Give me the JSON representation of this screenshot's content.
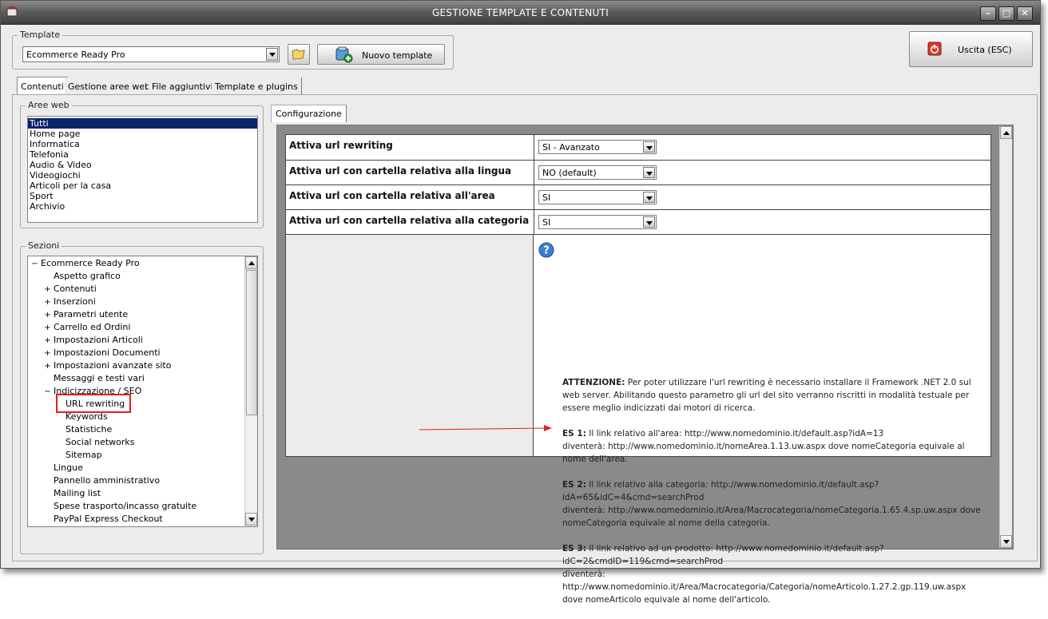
{
  "window": {
    "title": "GESTIONE TEMPLATE E CONTENUTI"
  },
  "template": {
    "group_label": "Template",
    "selected": "Ecommerce Ready Pro",
    "new_button": "Nuovo template"
  },
  "exit_button": "Uscita (ESC)",
  "tabs": [
    "Contenuti",
    "Gestione aree web",
    "File aggiuntivi",
    "Template e plugins"
  ],
  "aree_web": {
    "label": "Aree web",
    "items": [
      "Tutti",
      "Home page",
      "Informatica",
      "Telefonia",
      "Audio & Video",
      "Videogiochi",
      "Articoli per la casa",
      "Sport",
      "Archivio"
    ]
  },
  "sezioni": {
    "label": "Sezioni",
    "nodes": [
      {
        "text": "Ecommerce Ready Pro",
        "level": 0,
        "exp": "−"
      },
      {
        "text": "Aspetto grafico",
        "level": 1,
        "exp": ""
      },
      {
        "text": "Contenuti",
        "level": 1,
        "exp": "+"
      },
      {
        "text": "Inserzioni",
        "level": 1,
        "exp": "+"
      },
      {
        "text": "Parametri utente",
        "level": 1,
        "exp": "+"
      },
      {
        "text": "Carrello ed Ordini",
        "level": 1,
        "exp": "+"
      },
      {
        "text": "Impostazioni Articoli",
        "level": 1,
        "exp": "+"
      },
      {
        "text": "Impostazioni Documenti",
        "level": 1,
        "exp": "+"
      },
      {
        "text": "Impostazioni avanzate sito",
        "level": 1,
        "exp": "+"
      },
      {
        "text": "Messaggi e testi vari",
        "level": 1,
        "exp": ""
      },
      {
        "text": "Indicizzazione / SEO",
        "level": 1,
        "exp": "−"
      },
      {
        "text": "URL rewriting",
        "level": 2,
        "exp": ""
      },
      {
        "text": "Keywords",
        "level": 2,
        "exp": ""
      },
      {
        "text": "Statistiche",
        "level": 2,
        "exp": ""
      },
      {
        "text": "Social networks",
        "level": 2,
        "exp": ""
      },
      {
        "text": "Sitemap",
        "level": 2,
        "exp": ""
      },
      {
        "text": "Lingue",
        "level": 1,
        "exp": ""
      },
      {
        "text": "Pannello amministrativo",
        "level": 1,
        "exp": ""
      },
      {
        "text": "Mailing list",
        "level": 1,
        "exp": ""
      },
      {
        "text": "Spese trasporto/incasso gratuite",
        "level": 1,
        "exp": ""
      },
      {
        "text": "PayPal Express Checkout",
        "level": 1,
        "exp": ""
      }
    ]
  },
  "config": {
    "tab": "Configurazione",
    "rows": [
      {
        "label": "Attiva url rewriting",
        "value": "SI - Avanzato"
      },
      {
        "label": "Attiva url con cartella relativa alla lingua",
        "value": "NO (default)"
      },
      {
        "label": "Attiva url con cartella relativa all'area",
        "value": "SI"
      },
      {
        "label": "Attiva url con cartella relativa alla categoria",
        "value": "SI"
      }
    ],
    "info": {
      "attention_title": "ATTENZIONE:",
      "attention_text": " Per poter utilizzare l'url rewriting è necessario installare il Framework .NET 2.0 sul web server. Abilitando questo parametro gli url del sito verranno riscritti in modalità testuale per essere meglio indicizzati dai motori di ricerca.",
      "ex1_title": "ES 1:",
      "ex1_text": " Il link relativo all'area: http://www.nomedominio.it/default.asp?idA=13",
      "ex1_text2": "diventerà: http://www.nomedominio.it/nomeArea.1.13.uw.aspx dove nomeCategoria equivale al nome dell'area.",
      "ex2_title": "ES 2:",
      "ex2_text": " Il link relativo alla categoria: http://www.nomedominio.it/default.asp?idA=65&idC=4&cmd=searchProd",
      "ex2_text2": "diventerà: http://www.nomedominio.it/Area/Macrocategoria/nomeCategoria.1.65.4.sp.uw.aspx dove nomeCategoria equivale al nome della categoria.",
      "ex3_title": "ES 3:",
      "ex3_text": " Il link relativo ad un prodotto: http://www.nomedominio.it/default.asp?idC=2&cmdID=119&cmd=searchProd",
      "ex3_text2": "diventerà: http://www.nomedominio.it/Area/Macrocategoria/Categoria/nomeArticolo.1.27.2.gp.119.uw.aspx dove nomeArticolo equivale al nome dell'articolo."
    }
  },
  "colors": {
    "selection": "#0a246a",
    "annotation": "#e02020",
    "panel_bg": "#8a8a8a"
  }
}
